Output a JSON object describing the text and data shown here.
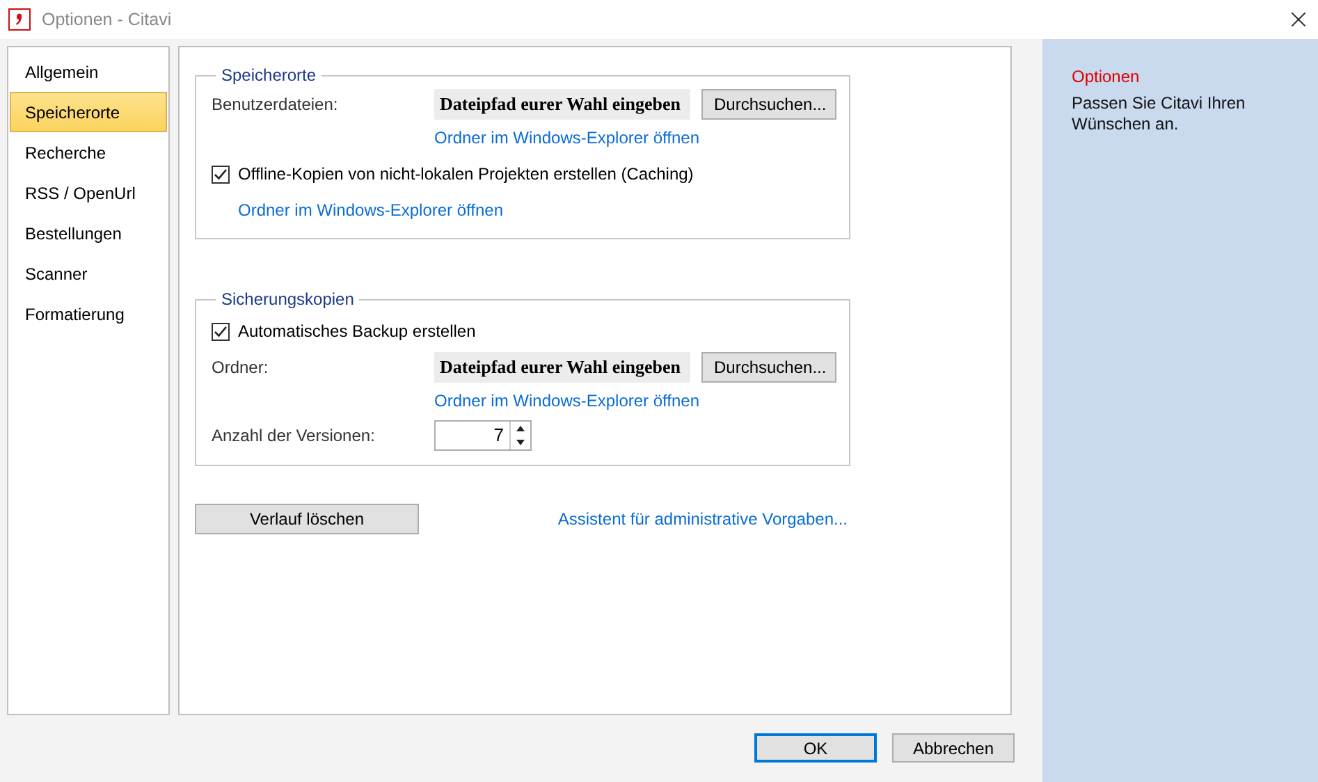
{
  "window": {
    "title": "Optionen - Citavi"
  },
  "sidebar": {
    "items": [
      {
        "label": "Allgemein",
        "selected": false
      },
      {
        "label": "Speicherorte",
        "selected": true
      },
      {
        "label": "Recherche",
        "selected": false
      },
      {
        "label": "RSS / OpenUrl",
        "selected": false
      },
      {
        "label": "Bestellungen",
        "selected": false
      },
      {
        "label": "Scanner",
        "selected": false
      },
      {
        "label": "Formatierung",
        "selected": false
      }
    ]
  },
  "groups": [
    {
      "title": "Speicherorte",
      "rows": [
        {
          "kind": "path",
          "label": "Benutzerdateien:",
          "value": "Dateipfad eurer Wahl eingeben",
          "button": "Durchsuchen..."
        },
        {
          "kind": "fieldlink",
          "link": "Ordner im Windows-Explorer öffnen"
        },
        {
          "kind": "checkbox",
          "label": "Offline-Kopien von nicht-lokalen Projekten erstellen (Caching)",
          "checked": true
        },
        {
          "kind": "optionlink",
          "link": "Ordner im Windows-Explorer öffnen"
        }
      ]
    },
    {
      "title": "Sicherungskopien",
      "rows": [
        {
          "kind": "checkbox",
          "label": "Automatisches Backup erstellen",
          "checked": true
        },
        {
          "kind": "path",
          "label": "Ordner:",
          "value": "Dateipfad eurer Wahl eingeben",
          "button": "Durchsuchen..."
        },
        {
          "kind": "fieldlink",
          "link": "Ordner im Windows-Explorer öffnen"
        },
        {
          "kind": "spin",
          "label": "Anzahl der Versionen:",
          "value": "7"
        }
      ]
    }
  ],
  "actions": {
    "button": "Verlauf löschen",
    "link": "Assistent für administrative Vorgaben..."
  },
  "footer": {
    "buttons": [
      {
        "label": "OK",
        "default": true
      },
      {
        "label": "Abbrechen",
        "default": false
      }
    ]
  },
  "info": {
    "title": "Optionen",
    "text": "Passen Sie Citavi Ihren Wünschen an."
  }
}
